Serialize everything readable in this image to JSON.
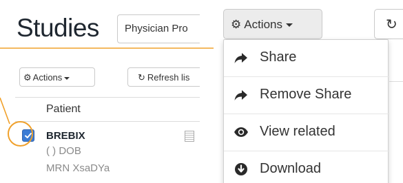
{
  "left": {
    "title": "Studies",
    "filter_value": "Physician Pro",
    "actions_label": "Actions",
    "refresh_label": "Refresh lis",
    "columns": {
      "patient": "Patient"
    },
    "row": {
      "checked": true,
      "name": "BREBIX",
      "dob": "( ) DOB",
      "mrn": "MRN XsaDYa"
    }
  },
  "right": {
    "actions_label": "Actions",
    "menu": [
      {
        "label": "Share",
        "icon": "share-arrow-icon"
      },
      {
        "label": "Remove Share",
        "icon": "share-arrow-icon"
      },
      {
        "label": "View related",
        "icon": "eye-icon"
      },
      {
        "label": "Download",
        "icon": "download-circle-icon"
      }
    ]
  },
  "colors": {
    "highlight": "#f0a02a",
    "checkbox": "#3a7bd5",
    "title": "#1f2730"
  }
}
